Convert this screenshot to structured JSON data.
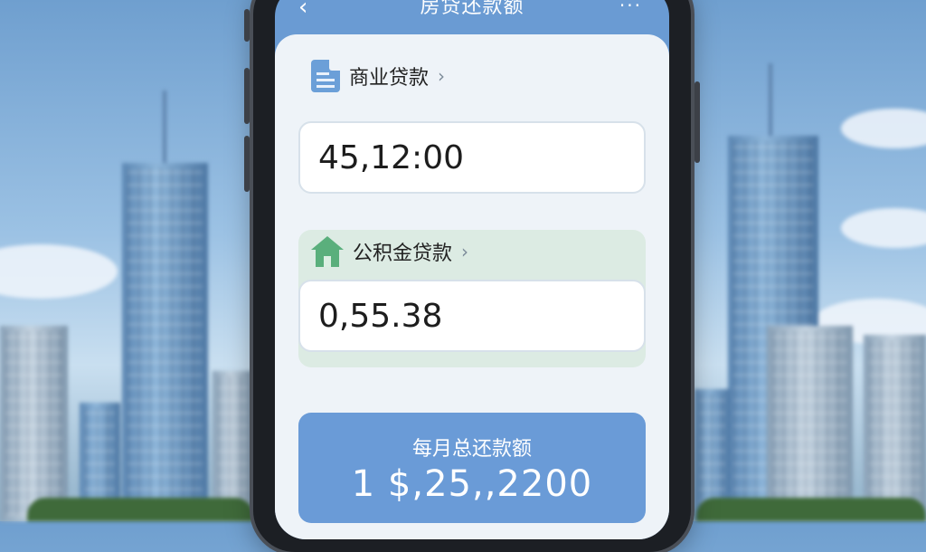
{
  "header": {
    "title": "房贷还款额",
    "back_icon": "chevron-left-icon",
    "more_icon": "more-dots-icon"
  },
  "commercial_loan": {
    "label": "商业贷款",
    "value": "45,12:00",
    "icon": "document-icon"
  },
  "provident_loan": {
    "label": "公积金贷款",
    "value": "0,55.38",
    "icon": "house-icon"
  },
  "monthly_payment": {
    "label": "每月总还款额",
    "value": "1  $,25,,2200"
  },
  "colors": {
    "accent": "#6a9bd7",
    "green": "#5aaf7c"
  }
}
